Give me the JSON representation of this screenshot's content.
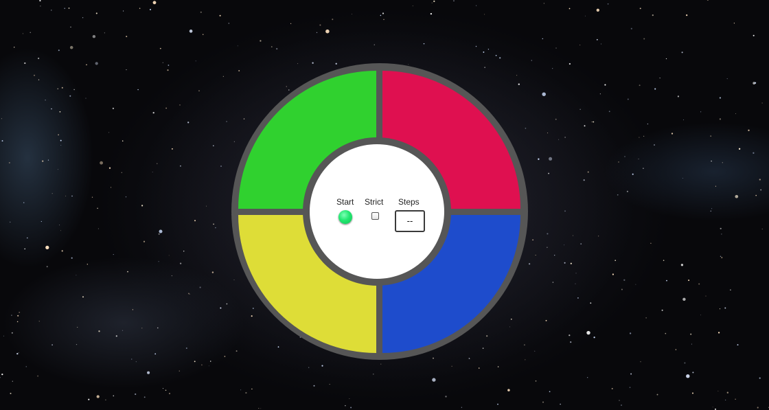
{
  "background": {
    "scene": "spiral-galaxy",
    "base_color": "#08080b"
  },
  "board": {
    "rim_color": "#565656",
    "quadrants": [
      {
        "position": "top-left",
        "color": "#30d12f"
      },
      {
        "position": "top-right",
        "color": "#df1050"
      },
      {
        "position": "bottom-left",
        "color": "#dedd37"
      },
      {
        "position": "bottom-right",
        "color": "#1e4ccc"
      }
    ]
  },
  "controls": {
    "start_label": "Start",
    "strict_label": "Strict",
    "steps_label": "Steps",
    "steps_value": "--",
    "strict_checked": false,
    "start_color": "#22e870"
  }
}
